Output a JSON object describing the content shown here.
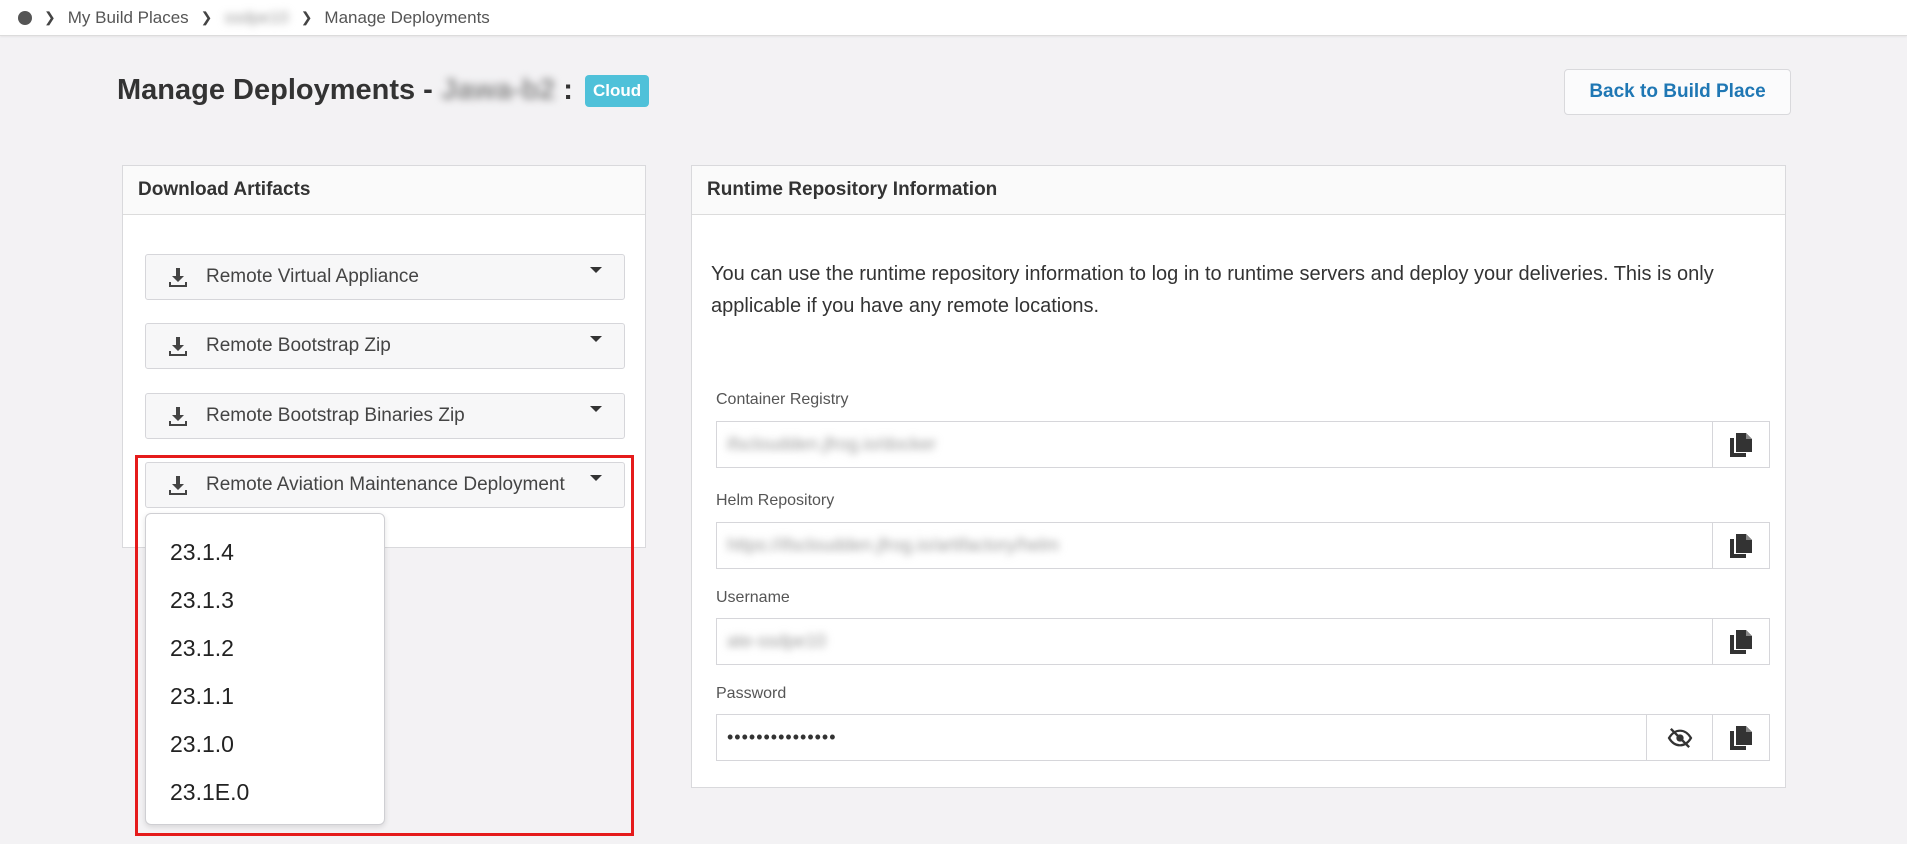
{
  "breadcrumb": {
    "items": [
      "My Build Places",
      "ssdpe10",
      "Manage Deployments"
    ]
  },
  "header": {
    "title_prefix": "Manage Deployments -",
    "build_place": "Jawa-b2",
    "separator": ":",
    "badge": "Cloud",
    "back_button": "Back to Build Place"
  },
  "download": {
    "title": "Download Artifacts",
    "items": [
      {
        "label": "Remote Virtual Appliance"
      },
      {
        "label": "Remote Bootstrap Zip"
      },
      {
        "label": "Remote Bootstrap Binaries Zip"
      },
      {
        "label": "Remote Aviation Maintenance Deployment"
      }
    ],
    "dropdown_options": [
      "23.1.4",
      "23.1.3",
      "23.1.2",
      "23.1.1",
      "23.1.0",
      "23.1E.0"
    ]
  },
  "runtime": {
    "title": "Runtime Repository Information",
    "description": "You can use the runtime repository information to log in to runtime servers and deploy your deliveries. This is only applicable if you have any remote locations.",
    "fields": [
      {
        "label": "Container Registry",
        "value": "ifscloudden.jfrog.io/docker"
      },
      {
        "label": "Helm Repository",
        "value": "https://ifscloudden.jfrog.io/artifactory/helm"
      },
      {
        "label": "Username",
        "value": "ate-ssdpe10"
      },
      {
        "label": "Password",
        "value": "•••••••••••••••"
      }
    ]
  },
  "colors": {
    "badge": "#4fc1d9",
    "link": "#1f77b4",
    "highlight": "#e51b1b"
  }
}
